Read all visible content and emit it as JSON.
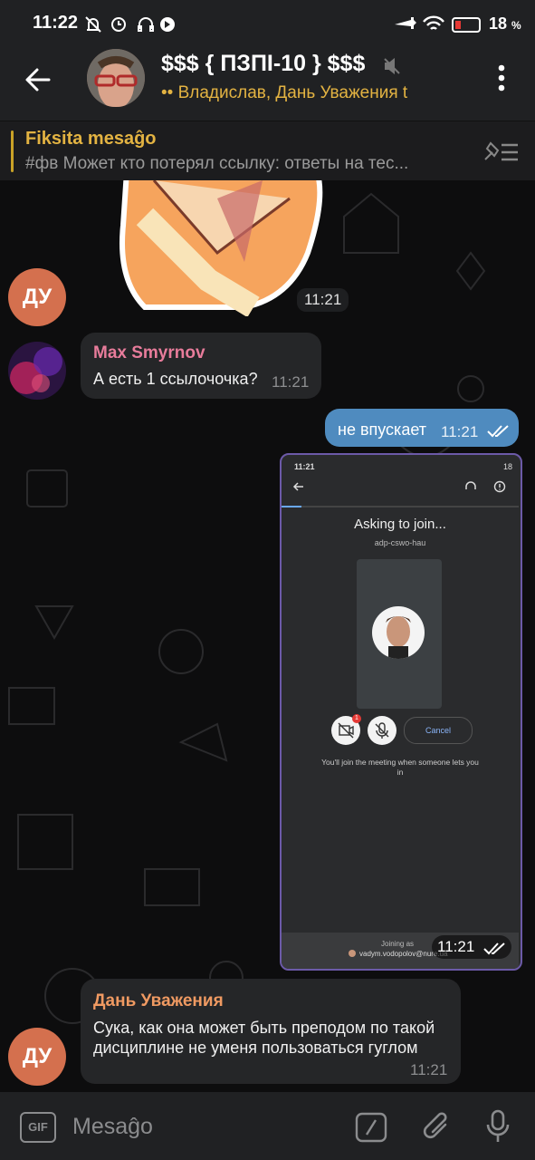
{
  "status_bar": {
    "time": "11:22",
    "battery": "18",
    "battery_unit": "%"
  },
  "header": {
    "title": "$$$ { ПЗПІ-10 } $$$",
    "subtitle": "•• Владислав, Дань Уважения t",
    "back_icon": "arrow-left-icon",
    "menu_icon": "more-vert-icon"
  },
  "pinned": {
    "title": "Fiksita mesaĝo",
    "text": "#фв  Может кто потерял ссылку: ответы на тес..."
  },
  "messages": [
    {
      "sender_initials": "ДУ",
      "time": "11:21"
    },
    {
      "sender": "Max Smyrnov",
      "text": "А есть 1 ссылочочка?",
      "time": "11:21"
    },
    {
      "text": "не впускает",
      "time": "11:21"
    },
    {
      "time": "11:21",
      "screenshot": {
        "time": "11:21",
        "battery": "18",
        "title": "Asking to join...",
        "code": "adp-cswo-hau",
        "badge": "1",
        "cancel": "Cancel",
        "hint": "You'll join the meeting when someone lets you in",
        "joining_as": "Joining as",
        "email": "vadym.vodopolov@nure.ua"
      }
    },
    {
      "sender": "Дань Уважения",
      "sender_initials": "ДУ",
      "text": "Сука, как она может быть преподом по такой дисциплине не уменя пользоваться гуглом",
      "time": "11:21"
    }
  ],
  "composer": {
    "placeholder": "Mesaĝo",
    "gif_label": "GIF"
  },
  "colors": {
    "accent": "#e3b342",
    "outgoing": "#4f8bbf",
    "avatar_du": "#d4704e",
    "max_name": "#e87c9b",
    "dan_name": "#f09a62"
  }
}
